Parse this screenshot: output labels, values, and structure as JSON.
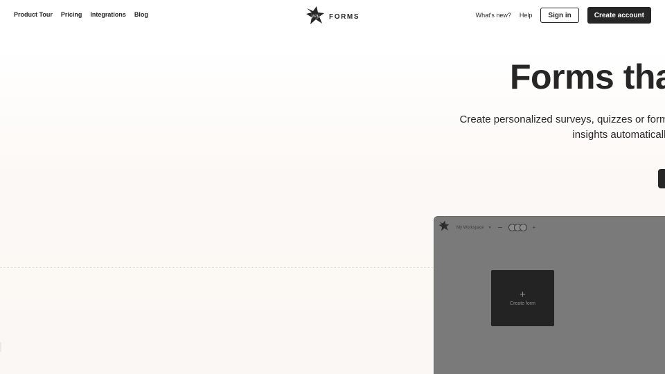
{
  "nav": {
    "left_items": [
      {
        "label": "Product Tour"
      },
      {
        "label": "Pricing"
      },
      {
        "label": "Integrations"
      },
      {
        "label": "Blog"
      }
    ],
    "logo_text": "FORMS",
    "whats_new": "What's new?",
    "help": "Help",
    "sign_in": "Sign in",
    "create_account": "Create account"
  },
  "hero": {
    "title": "Forms tha",
    "subtitle_line1": "Create personalized surveys, quizzes or forms",
    "subtitle_line2": "insights automatically,"
  },
  "preview": {
    "workspace_label": "My Workspace",
    "create_form_label": "Create form",
    "plus_symbol": "+",
    "avatar_count": 3
  },
  "colors": {
    "text": "#262627",
    "primary_button": "#262627",
    "preview_overlay": "#7a7a7a",
    "create_card": "#232323"
  },
  "icons": [
    "yay-logo-icon",
    "chevron-down-icon",
    "plus-icon",
    "avatar-icon"
  ]
}
